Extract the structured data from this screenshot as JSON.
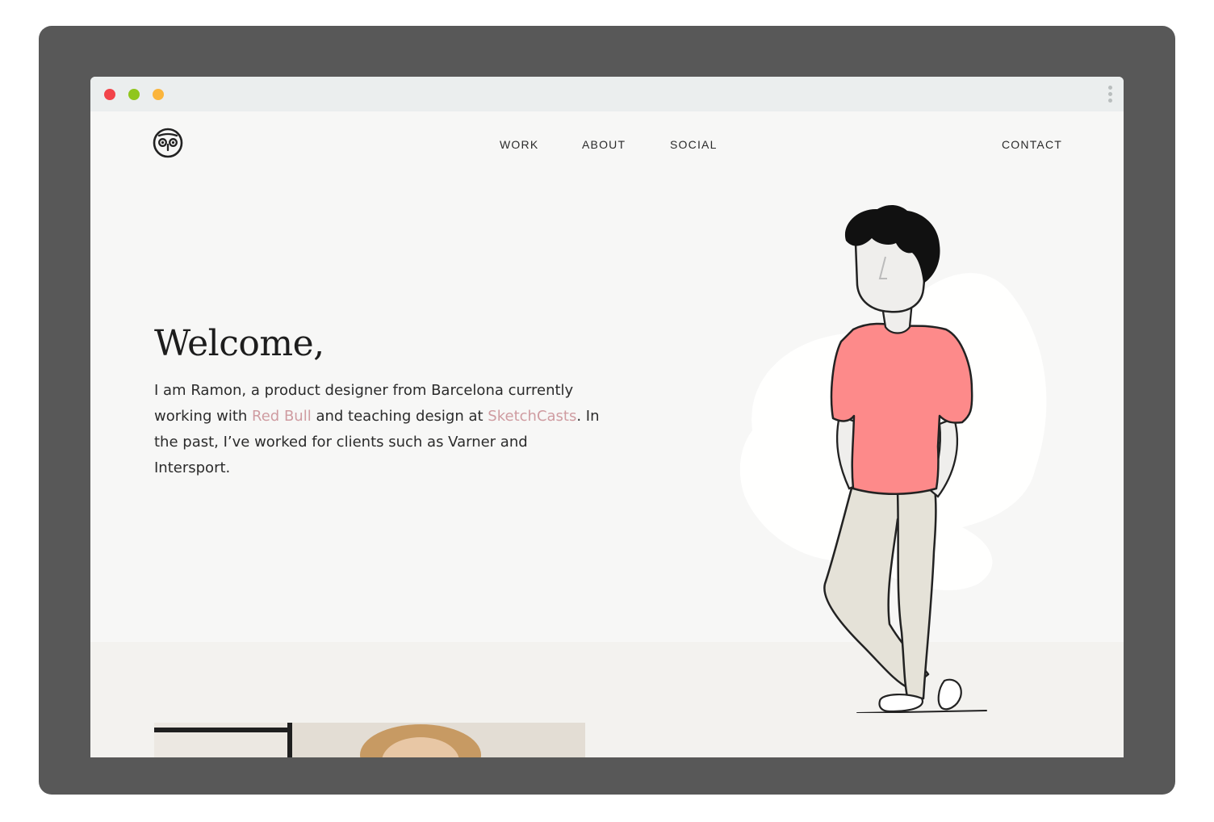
{
  "window": {
    "controls": {
      "close_color": "#f2444a",
      "minimize_color": "#90c61c",
      "maximize_color": "#fbb53c"
    },
    "menu_icon": "kebab-menu-icon"
  },
  "header": {
    "logo_icon": "owl-face-logo-icon",
    "nav": {
      "work": "WORK",
      "about": "ABOUT",
      "social": "SOCIAL",
      "contact": "CONTACT"
    }
  },
  "hero": {
    "title": "Welcome,",
    "intro_prefix": "I am Ramon, a product designer from Barcelona currently working with ",
    "link_red_bull": "Red Bull",
    "intro_middle": " and teaching design at ",
    "link_sketchcasts": "SketchCasts",
    "intro_suffix": ". In the past, I’ve worked for clients such as Varner and Intersport.",
    "link_color": "#cf9ca1",
    "illustration": "man-standing-illustration"
  },
  "colors": {
    "page_background": "#f7f7f6",
    "shirt": "#fd8a8a",
    "pants": "#e5e2d8"
  }
}
